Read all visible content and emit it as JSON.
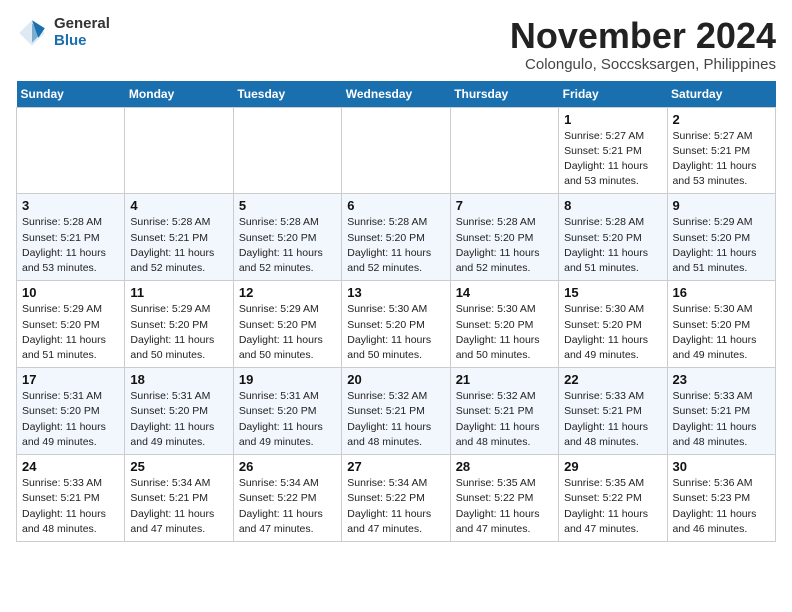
{
  "header": {
    "logo_general": "General",
    "logo_blue": "Blue",
    "month": "November 2024",
    "location": "Colongulo, Soccsksargen, Philippines"
  },
  "days_of_week": [
    "Sunday",
    "Monday",
    "Tuesday",
    "Wednesday",
    "Thursday",
    "Friday",
    "Saturday"
  ],
  "weeks": [
    [
      {
        "day": "",
        "info": ""
      },
      {
        "day": "",
        "info": ""
      },
      {
        "day": "",
        "info": ""
      },
      {
        "day": "",
        "info": ""
      },
      {
        "day": "",
        "info": ""
      },
      {
        "day": "1",
        "info": "Sunrise: 5:27 AM\nSunset: 5:21 PM\nDaylight: 11 hours\nand 53 minutes."
      },
      {
        "day": "2",
        "info": "Sunrise: 5:27 AM\nSunset: 5:21 PM\nDaylight: 11 hours\nand 53 minutes."
      }
    ],
    [
      {
        "day": "3",
        "info": "Sunrise: 5:28 AM\nSunset: 5:21 PM\nDaylight: 11 hours\nand 53 minutes."
      },
      {
        "day": "4",
        "info": "Sunrise: 5:28 AM\nSunset: 5:21 PM\nDaylight: 11 hours\nand 52 minutes."
      },
      {
        "day": "5",
        "info": "Sunrise: 5:28 AM\nSunset: 5:20 PM\nDaylight: 11 hours\nand 52 minutes."
      },
      {
        "day": "6",
        "info": "Sunrise: 5:28 AM\nSunset: 5:20 PM\nDaylight: 11 hours\nand 52 minutes."
      },
      {
        "day": "7",
        "info": "Sunrise: 5:28 AM\nSunset: 5:20 PM\nDaylight: 11 hours\nand 52 minutes."
      },
      {
        "day": "8",
        "info": "Sunrise: 5:28 AM\nSunset: 5:20 PM\nDaylight: 11 hours\nand 51 minutes."
      },
      {
        "day": "9",
        "info": "Sunrise: 5:29 AM\nSunset: 5:20 PM\nDaylight: 11 hours\nand 51 minutes."
      }
    ],
    [
      {
        "day": "10",
        "info": "Sunrise: 5:29 AM\nSunset: 5:20 PM\nDaylight: 11 hours\nand 51 minutes."
      },
      {
        "day": "11",
        "info": "Sunrise: 5:29 AM\nSunset: 5:20 PM\nDaylight: 11 hours\nand 50 minutes."
      },
      {
        "day": "12",
        "info": "Sunrise: 5:29 AM\nSunset: 5:20 PM\nDaylight: 11 hours\nand 50 minutes."
      },
      {
        "day": "13",
        "info": "Sunrise: 5:30 AM\nSunset: 5:20 PM\nDaylight: 11 hours\nand 50 minutes."
      },
      {
        "day": "14",
        "info": "Sunrise: 5:30 AM\nSunset: 5:20 PM\nDaylight: 11 hours\nand 50 minutes."
      },
      {
        "day": "15",
        "info": "Sunrise: 5:30 AM\nSunset: 5:20 PM\nDaylight: 11 hours\nand 49 minutes."
      },
      {
        "day": "16",
        "info": "Sunrise: 5:30 AM\nSunset: 5:20 PM\nDaylight: 11 hours\nand 49 minutes."
      }
    ],
    [
      {
        "day": "17",
        "info": "Sunrise: 5:31 AM\nSunset: 5:20 PM\nDaylight: 11 hours\nand 49 minutes."
      },
      {
        "day": "18",
        "info": "Sunrise: 5:31 AM\nSunset: 5:20 PM\nDaylight: 11 hours\nand 49 minutes."
      },
      {
        "day": "19",
        "info": "Sunrise: 5:31 AM\nSunset: 5:20 PM\nDaylight: 11 hours\nand 49 minutes."
      },
      {
        "day": "20",
        "info": "Sunrise: 5:32 AM\nSunset: 5:21 PM\nDaylight: 11 hours\nand 48 minutes."
      },
      {
        "day": "21",
        "info": "Sunrise: 5:32 AM\nSunset: 5:21 PM\nDaylight: 11 hours\nand 48 minutes."
      },
      {
        "day": "22",
        "info": "Sunrise: 5:33 AM\nSunset: 5:21 PM\nDaylight: 11 hours\nand 48 minutes."
      },
      {
        "day": "23",
        "info": "Sunrise: 5:33 AM\nSunset: 5:21 PM\nDaylight: 11 hours\nand 48 minutes."
      }
    ],
    [
      {
        "day": "24",
        "info": "Sunrise: 5:33 AM\nSunset: 5:21 PM\nDaylight: 11 hours\nand 48 minutes."
      },
      {
        "day": "25",
        "info": "Sunrise: 5:34 AM\nSunset: 5:21 PM\nDaylight: 11 hours\nand 47 minutes."
      },
      {
        "day": "26",
        "info": "Sunrise: 5:34 AM\nSunset: 5:22 PM\nDaylight: 11 hours\nand 47 minutes."
      },
      {
        "day": "27",
        "info": "Sunrise: 5:34 AM\nSunset: 5:22 PM\nDaylight: 11 hours\nand 47 minutes."
      },
      {
        "day": "28",
        "info": "Sunrise: 5:35 AM\nSunset: 5:22 PM\nDaylight: 11 hours\nand 47 minutes."
      },
      {
        "day": "29",
        "info": "Sunrise: 5:35 AM\nSunset: 5:22 PM\nDaylight: 11 hours\nand 47 minutes."
      },
      {
        "day": "30",
        "info": "Sunrise: 5:36 AM\nSunset: 5:23 PM\nDaylight: 11 hours\nand 46 minutes."
      }
    ]
  ]
}
